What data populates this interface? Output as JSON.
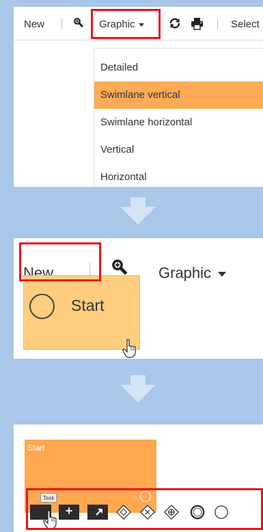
{
  "panel1": {
    "toolbar": {
      "new_label": "New",
      "graphic_label": "Graphic",
      "select_label": "Select"
    },
    "graphic_menu": {
      "items": [
        "Detailed",
        "Swimlane vertical",
        "Swimlane horizontal",
        "Vertical",
        "Horizontal"
      ],
      "selected": "Swimlane vertical"
    }
  },
  "panel2": {
    "toolbar": {
      "new_label": "New",
      "graphic_label": "Graphic"
    },
    "start_option_label": "Start"
  },
  "panel3": {
    "task_label": "Start",
    "tooltip_text": "Task",
    "palette_icons": [
      "task-icon",
      "subprocess-icon",
      "call-activity-icon",
      "exclusive-gateway-icon",
      "parallel-gateway-icon",
      "inclusive-gateway-icon",
      "end-event-icon",
      "start-event-icon"
    ]
  },
  "colors": {
    "background": "#a9c7e8",
    "highlight": "#e8141c",
    "menu_selected": "#ffab55",
    "start_chip": "#ffce7e",
    "task_block": "#ffa84f",
    "palette_dark": "#2c2c2c"
  }
}
